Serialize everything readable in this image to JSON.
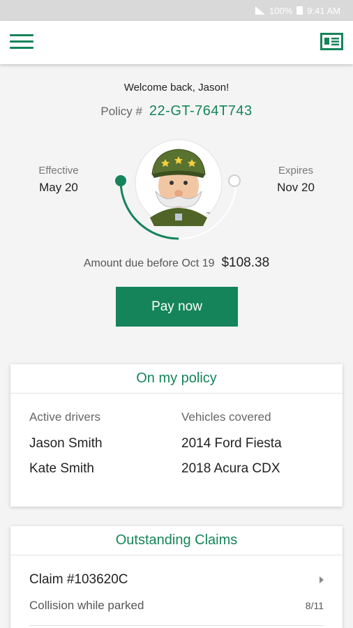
{
  "status_bar": {
    "battery": "100%",
    "time": "9:41 AM"
  },
  "colors": {
    "brand_green": "#15845a",
    "track_green": "#15845a"
  },
  "header": {
    "menu_icon": "hamburger-menu-icon",
    "card_icon": "id-card-icon"
  },
  "hero": {
    "welcome": "Welcome back, Jason!",
    "policy_label": "Policy #",
    "policy_number": "22-GT-764T743",
    "effective_label": "Effective",
    "effective_date": "May 20",
    "expires_label": "Expires",
    "expires_date": "Nov 20",
    "term_progress": 0.5,
    "mascot": "general-mascot",
    "amount_due_label": "Amount due before Oct 19",
    "amount_due": "$108.38",
    "pay_button": "Pay now"
  },
  "policy_card": {
    "title": "On my policy",
    "drivers_header": "Active drivers",
    "vehicles_header": "Vehicles covered",
    "drivers": [
      "Jason Smith",
      "Kate Smith"
    ],
    "vehicles": [
      "2014 Ford Fiesta",
      "2018 Acura CDX"
    ]
  },
  "claims_card": {
    "title": "Outstanding Claims",
    "claims": [
      {
        "number": "Claim #103620C",
        "description": "Collision while parked",
        "date": "8/11"
      }
    ]
  }
}
